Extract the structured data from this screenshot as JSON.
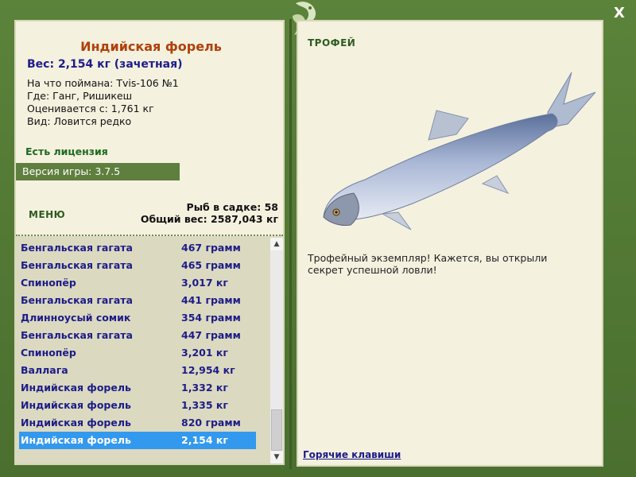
{
  "window": {
    "close_label": "X"
  },
  "fish": {
    "title": "Индийская форель",
    "weight": "Вес: 2,154 кг (зачетная)",
    "caught_on": "На что поймана: Tvis-106 №1",
    "location": "Где: Ганг, Ришикеш",
    "valued_from": "Оценивается с: 1,761 кг",
    "rarity": "Вид: Ловится редко"
  },
  "license": "Есть лицензия",
  "version": "Версия игры: 3.7.5",
  "menu_label": "МЕНЮ",
  "cage": {
    "count": "Рыб в садке: 58",
    "total": "Общий вес: 2587,043 кг"
  },
  "list": [
    {
      "name": "Бенгальская гагата",
      "weight": "467 грамм"
    },
    {
      "name": "Бенгальская гагата",
      "weight": "465 грамм"
    },
    {
      "name": "Спинопёр",
      "weight": "3,017 кг"
    },
    {
      "name": "Бенгальская гагата",
      "weight": "441 грамм"
    },
    {
      "name": "Длинноусый сомик",
      "weight": "354 грамм"
    },
    {
      "name": "Бенгальская гагата",
      "weight": "447 грамм"
    },
    {
      "name": "Спинопёр",
      "weight": "3,201 кг"
    },
    {
      "name": "Валлага",
      "weight": "12,954 кг"
    },
    {
      "name": "Индийская форель",
      "weight": "1,332 кг"
    },
    {
      "name": "Индийская форель",
      "weight": "1,335 кг"
    },
    {
      "name": "Индийская форель",
      "weight": "820 грамм"
    },
    {
      "name": "Индийская форель",
      "weight": "2,154 кг"
    }
  ],
  "selected_index": 11,
  "trophy": {
    "title": "ТРОФЕЙ",
    "text": "Трофейный экземпляр! Кажется, вы открыли секрет успешной ловли!"
  },
  "hotkeys_label": "Горячие клавиши",
  "colors": {
    "frame": "#4d7232",
    "panel": "#f4f1df",
    "title": "#b0400a",
    "text_blue": "#1c1c88",
    "selection": "#3399ee"
  }
}
